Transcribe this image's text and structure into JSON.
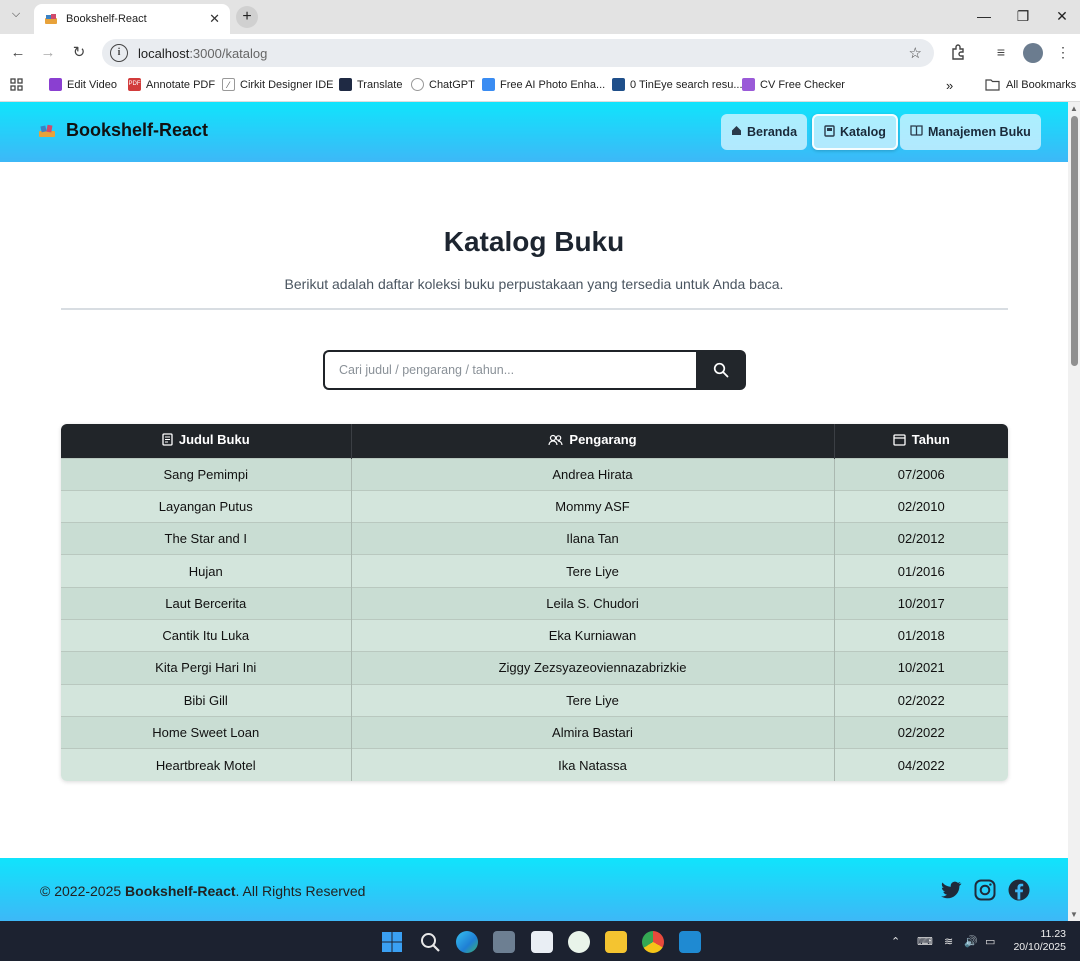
{
  "browser": {
    "tab_title": "Bookshelf-React",
    "url_host": "localhost",
    "url_path": ":3000/katalog",
    "bookmarks": [
      {
        "label": "Edit Video"
      },
      {
        "label": "Annotate PDF"
      },
      {
        "label": "Cirkit Designer IDE"
      },
      {
        "label": "Translate"
      },
      {
        "label": "ChatGPT"
      },
      {
        "label": "Free AI Photo Enha..."
      },
      {
        "label": "0 TinEye search resu..."
      },
      {
        "label": "CV Free Checker"
      }
    ],
    "all_bookmarks": "All Bookmarks"
  },
  "navbar": {
    "brand": "Bookshelf-React",
    "links": [
      {
        "label": "Beranda",
        "active": false
      },
      {
        "label": "Katalog",
        "active": true
      },
      {
        "label": "Manajemen Buku",
        "active": false
      }
    ]
  },
  "page": {
    "title": "Katalog Buku",
    "subtitle": "Berikut adalah daftar koleksi buku perpustakaan yang tersedia untuk Anda baca.",
    "search_placeholder": "Cari judul / pengarang / tahun..."
  },
  "table": {
    "headers": [
      "Judul Buku",
      "Pengarang",
      "Tahun"
    ],
    "rows": [
      [
        "Sang Pemimpi",
        "Andrea Hirata",
        "07/2006"
      ],
      [
        "Layangan Putus",
        "Mommy ASF",
        "02/2010"
      ],
      [
        "The Star and I",
        "Ilana Tan",
        "02/2012"
      ],
      [
        "Hujan",
        "Tere Liye",
        "01/2016"
      ],
      [
        "Laut Bercerita",
        "Leila S. Chudori",
        "10/2017"
      ],
      [
        "Cantik Itu Luka",
        "Eka Kurniawan",
        "01/2018"
      ],
      [
        "Kita Pergi Hari Ini",
        "Ziggy Zezsyazeoviennazabrizkie",
        "10/2021"
      ],
      [
        "Bibi Gill",
        "Tere Liye",
        "02/2022"
      ],
      [
        "Home Sweet Loan",
        "Almira Bastari",
        "02/2022"
      ],
      [
        "Heartbreak Motel",
        "Ika Natassa",
        "04/2022"
      ]
    ]
  },
  "footer": {
    "copy_prefix": "© 2022-2025 ",
    "brand": "Bookshelf-React",
    "copy_suffix": ". All Rights Reserved"
  },
  "taskbar": {
    "time": "11.23",
    "date": "20/10/2025"
  },
  "colors": {
    "navbar_gradient_top": "#10e4fc",
    "navbar_gradient_bottom": "#3db8f7",
    "table_header": "#212529",
    "row_odd": "#c9ddd3",
    "row_even": "#d3e5dc"
  }
}
